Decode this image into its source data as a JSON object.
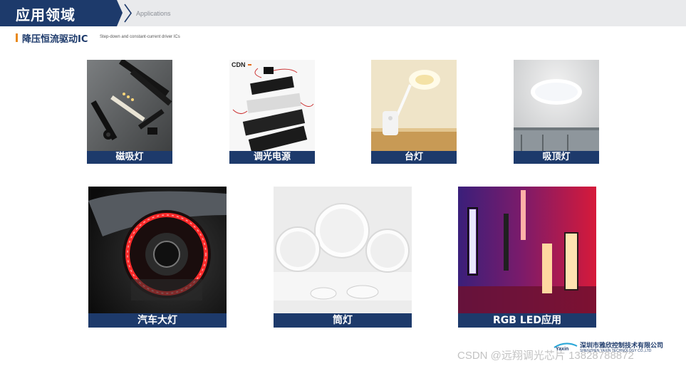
{
  "header": {
    "title": "应用领域",
    "subtitle": "Applications"
  },
  "section": {
    "title": "降压恒流驱动IC",
    "subtitle": "Step-down and constant-current driver ICs"
  },
  "products": [
    {
      "label": "磁吸灯",
      "icon": "magnetic-track-light-photo"
    },
    {
      "label": "调光电源",
      "icon": "dimming-power-supply-photo",
      "brand": "CDN"
    },
    {
      "label": "台灯",
      "icon": "desk-lamp-photo"
    },
    {
      "label": "吸顶灯",
      "icon": "ceiling-light-photo"
    },
    {
      "label": "汽车大灯",
      "icon": "car-headlight-photo"
    },
    {
      "label": "筒灯",
      "icon": "downlight-photo"
    },
    {
      "label": "RGB LED应用",
      "icon": "rgb-led-tubes-photo"
    }
  ],
  "footer": {
    "company_name": "深圳市雅欣控制技术有限公司",
    "company_en": "SHENZHEN YAXIN TECHNOLOGY CO.,LTD",
    "logo_text": "Yaxin",
    "watermark": "CSDN @远翔调光芯片 13828788872"
  },
  "colors": {
    "brand_navy": "#1d3a6b",
    "accent_orange": "#e8891c",
    "header_gray": "#e9eaec"
  }
}
